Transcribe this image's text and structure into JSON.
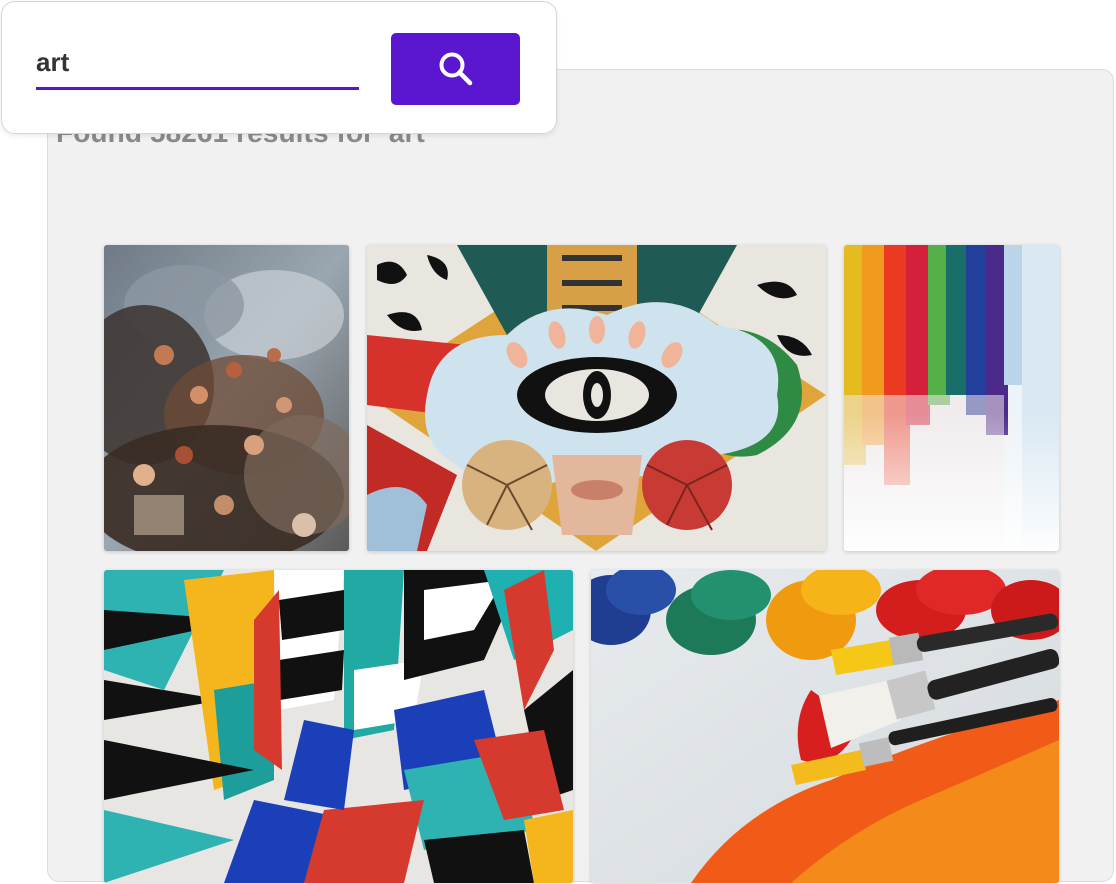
{
  "search": {
    "query": "art",
    "button_icon": "search-icon"
  },
  "results": {
    "heading": "Found 58261 results for 'art'",
    "items": [
      {
        "name": "result-baroque-ceiling-fresco",
        "thumbnail": "baroque ceiling fresco"
      },
      {
        "name": "result-eye-cloud-mural",
        "thumbnail": "eye cloud mural"
      },
      {
        "name": "result-rainbow-brush-strokes",
        "thumbnail": "rainbow brush strokes"
      },
      {
        "name": "result-geometric-abstract-mural",
        "thumbnail": "geometric abstract mural"
      },
      {
        "name": "result-paint-brushes-and-tubes",
        "thumbnail": "paint brushes and tubes"
      }
    ]
  },
  "colors": {
    "accent": "#5b16d0",
    "panel_background": "#f1f1f1",
    "heading_text": "#8a8a8a"
  }
}
